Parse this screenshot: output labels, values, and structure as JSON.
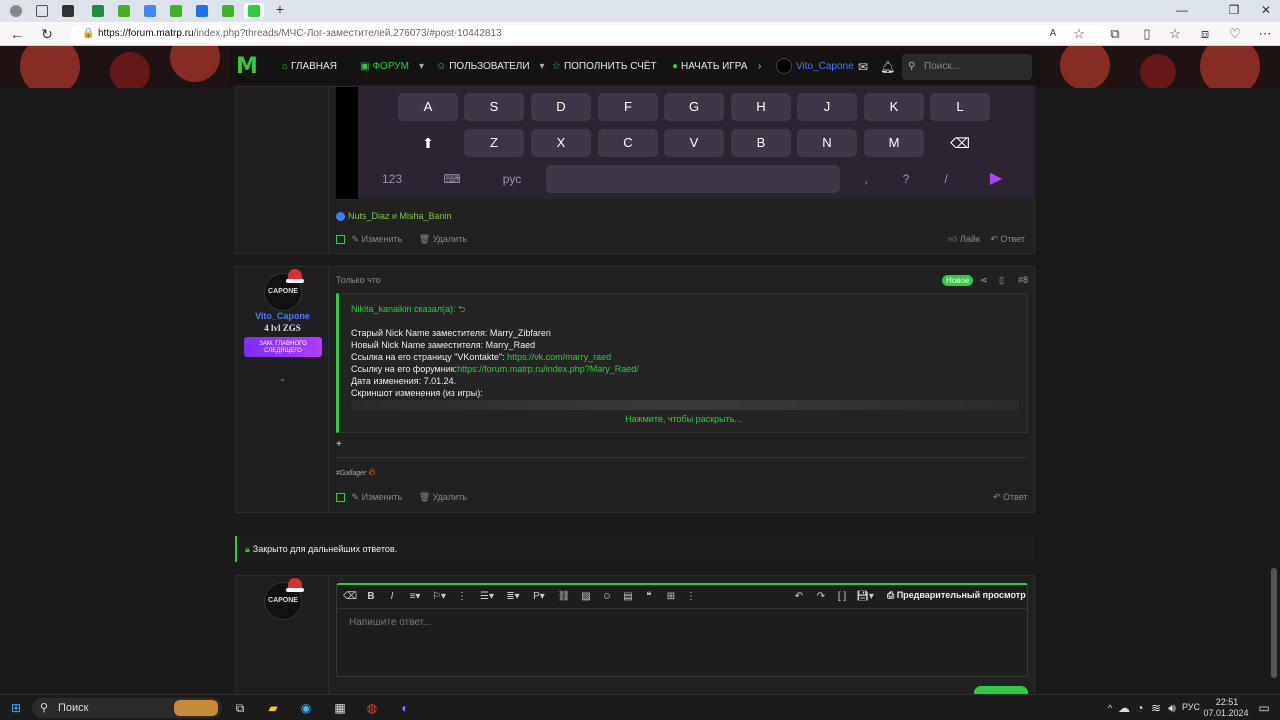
{
  "browser": {
    "url_host": "https://forum.matrp.ru",
    "url_rest": "/index.php?threads/МЧС-Лог-заместителей.276073/#post-10442813",
    "tab_icons": [
      "profile-icon",
      "tab-groups-icon",
      "tab-sheet-icon",
      "tab-sheet2-icon",
      "tab-whatsapp-icon",
      "tab-docs-icon",
      "tab-w-icon",
      "tab-chat-icon",
      "tab-w2-icon",
      "tab-matrp-icon"
    ],
    "new_tab": "+",
    "window_controls": [
      "—",
      "❐",
      "✕"
    ]
  },
  "site": {
    "logo": "M",
    "nav": {
      "home": "ГЛАВНАЯ",
      "forum": "ФОРУМ",
      "users": "ПОЛЬЗОВАТЕЛИ",
      "topup": "ПОПОЛНИТЬ СЧЁТ",
      "play": "НАЧАТЬ ИГРА",
      "username": "Vito_Capone",
      "search_placeholder": "Поиск..."
    },
    "accent": "#2ecc40"
  },
  "keyboard": {
    "row1": [
      "A",
      "S",
      "D",
      "F",
      "G",
      "H",
      "J",
      "K",
      "L"
    ],
    "row2": [
      "Z",
      "X",
      "C",
      "V",
      "B",
      "N",
      "M"
    ],
    "row3_left": [
      "123",
      "рус"
    ],
    "row3_right": [
      ",",
      "?",
      "/"
    ],
    "shift": "⬆",
    "backspace": "⌫"
  },
  "post1": {
    "reactions": "Nuts_Diaz и Misha_Banin",
    "edit": "Изменить",
    "delete": "Удалить",
    "like": "Лайк",
    "reply": "Ответ"
  },
  "post2": {
    "time": "Только что",
    "badge": "Новое",
    "number": "#8",
    "author": "Vito_Capone",
    "avatar_text": "CAPONE",
    "rank": "4 lvl ZGS",
    "banner": "ЗАМ. ГЛАВНОГО СЛЕДЯЩЕГО",
    "quote_author": "Nikita_kanaikin сказал(а):",
    "lines": {
      "l1": "Старый Nick Name заместителя: Marry_Zibfaren",
      "l2": "Новый Nick Name заместителя: Marry_Raed",
      "l3a": "Ссылка на его страницу \"VKontakte\": ",
      "l3b": "https://vk.com/marry_raed",
      "l4a": "Ссылку на его форумник:",
      "l4b": "https://forum.matrp.ru/index.php?Mary_Raed/",
      "l5": "Дата изменения: 7.01.24.",
      "l6": "Скриншот изменения (из игры):"
    },
    "expand": "Нажмите, чтобы раскрыть...",
    "plus": "+",
    "signature": "#Gallager",
    "edit": "Изменить",
    "delete": "Удалить",
    "reply": "Ответ"
  },
  "closed": "Закрыто для дальнейших ответов.",
  "editor": {
    "avatar_text": "CAPONE",
    "preview": "Предварительный просмотр",
    "placeholder": "Напишите ответ..."
  },
  "taskbar": {
    "search": "Поиск",
    "lang": "РУС",
    "time": "22:51",
    "date": "07.01.2024"
  }
}
